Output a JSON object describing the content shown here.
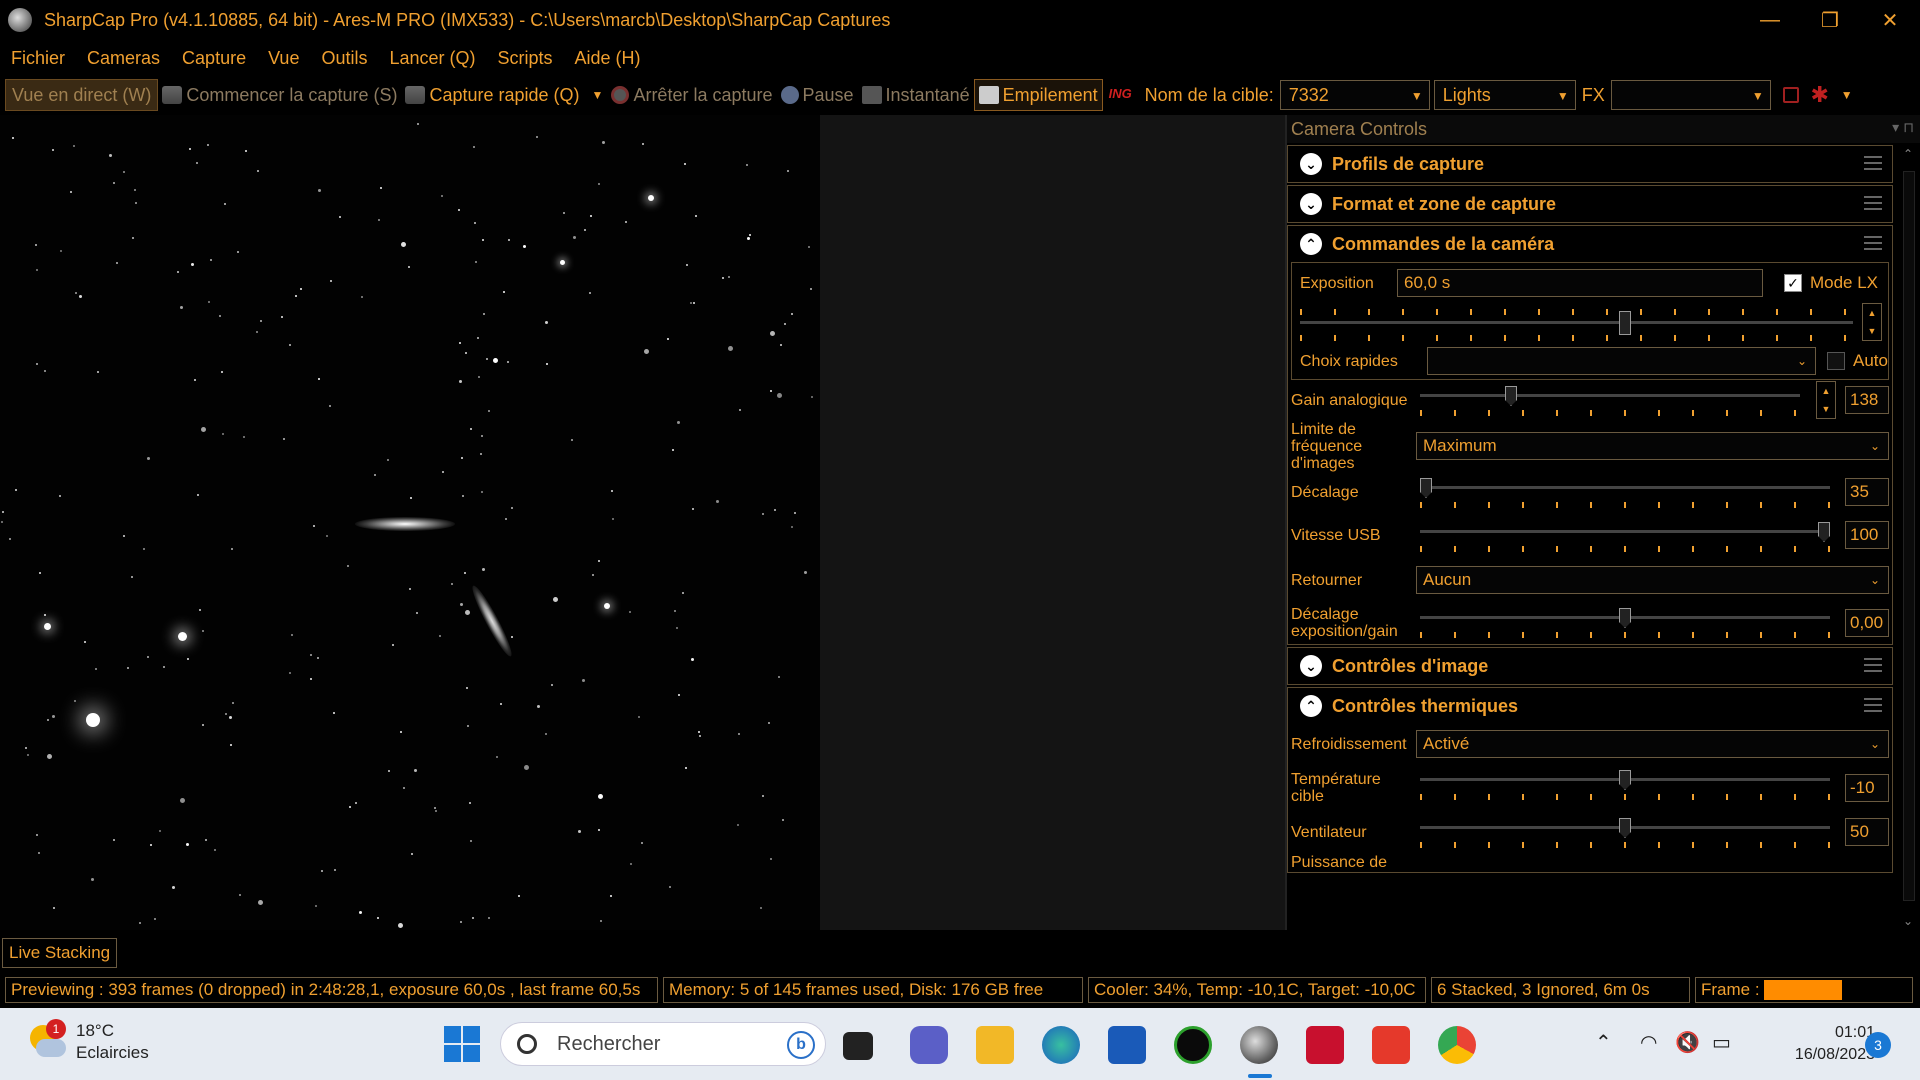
{
  "window": {
    "title": "SharpCap Pro (v4.1.10885, 64 bit) - Ares-M PRO (IMX533) - C:\\Users\\marcb\\Desktop\\SharpCap Captures",
    "controls": [
      "—",
      "❐",
      "✕"
    ]
  },
  "menu": [
    "Fichier",
    "Cameras",
    "Capture",
    "Vue",
    "Outils",
    "Lancer (Q)",
    "Scripts",
    "Aide (H)"
  ],
  "toolbar": {
    "live_view": "Vue en direct (W)",
    "start_capture": "Commencer la capture (S)",
    "quick_capture": "Capture rapide (Q)",
    "stop_capture": "Arrêter la capture",
    "pause": "Pause",
    "snapshot": "Instantané",
    "stacking": "Empilement",
    "inog_icon": "ING",
    "target_label": "Nom de la cible:",
    "target_value": "7332",
    "frame_type": "Lights",
    "fx_label": "FX",
    "fx_value": ""
  },
  "panel": {
    "header": "Camera Controls",
    "sections": {
      "profiles": "Profils de capture",
      "format": "Format et zone de capture",
      "camera": "Commandes de la caméra",
      "image": "Contrôles d'image",
      "thermal": "Contrôles thermiques"
    },
    "camera": {
      "exposure_label": "Exposition",
      "exposure_value": "60,0 s",
      "lx_mode_label": "Mode LX",
      "exposure_slider_level": 0.57,
      "quick_choice_label": "Choix rapides",
      "quick_choice_value": "",
      "auto_label": "Auto",
      "gain_label": "Gain analogique",
      "gain_value": "138",
      "gain_level": 0.23,
      "frame_limit_label": "Limite de fréquence d'images",
      "frame_limit_value": "Maximum",
      "offset_label": "Décalage",
      "offset_value": "35",
      "offset_level": 0.0,
      "usb_label": "Vitesse USB",
      "usb_value": "100",
      "usb_level": 1.0,
      "flip_label": "Retourner",
      "flip_value": "Aucun",
      "exp_gain_offset_label": "Décalage exposition/gain",
      "exp_gain_offset_value": "0,00",
      "exp_gain_level": 0.5
    },
    "thermal": {
      "cooling_label": "Refroidissement",
      "cooling_value": "Activé",
      "target_temp_label": "Température cible",
      "target_temp_value": "-10",
      "target_temp_level": 0.5,
      "fan_label": "Ventilateur",
      "fan_value": "50",
      "fan_level": 0.5,
      "power_label": "Puissance de"
    }
  },
  "live_stacking_tab": "Live Stacking",
  "status": {
    "preview": "Previewing : 393 frames (0 dropped) in 2:48:28,1, exposure 60,0s , last frame 60,5s",
    "memory": "Memory: 5 of 145 frames used, Disk: 176 GB free",
    "cooler": "Cooler: 34%, Temp: -10,1C, Target: -10,0C",
    "stacked": "6 Stacked, 3 Ignored, 6m 0s",
    "frame_label": "Frame :"
  },
  "taskbar": {
    "weather_temp": "18°C",
    "weather_desc": "Eclaircies",
    "weather_badge": "1",
    "search_placeholder": "Rechercher",
    "time": "01:01",
    "date": "16/08/2023",
    "notifications": "3"
  }
}
